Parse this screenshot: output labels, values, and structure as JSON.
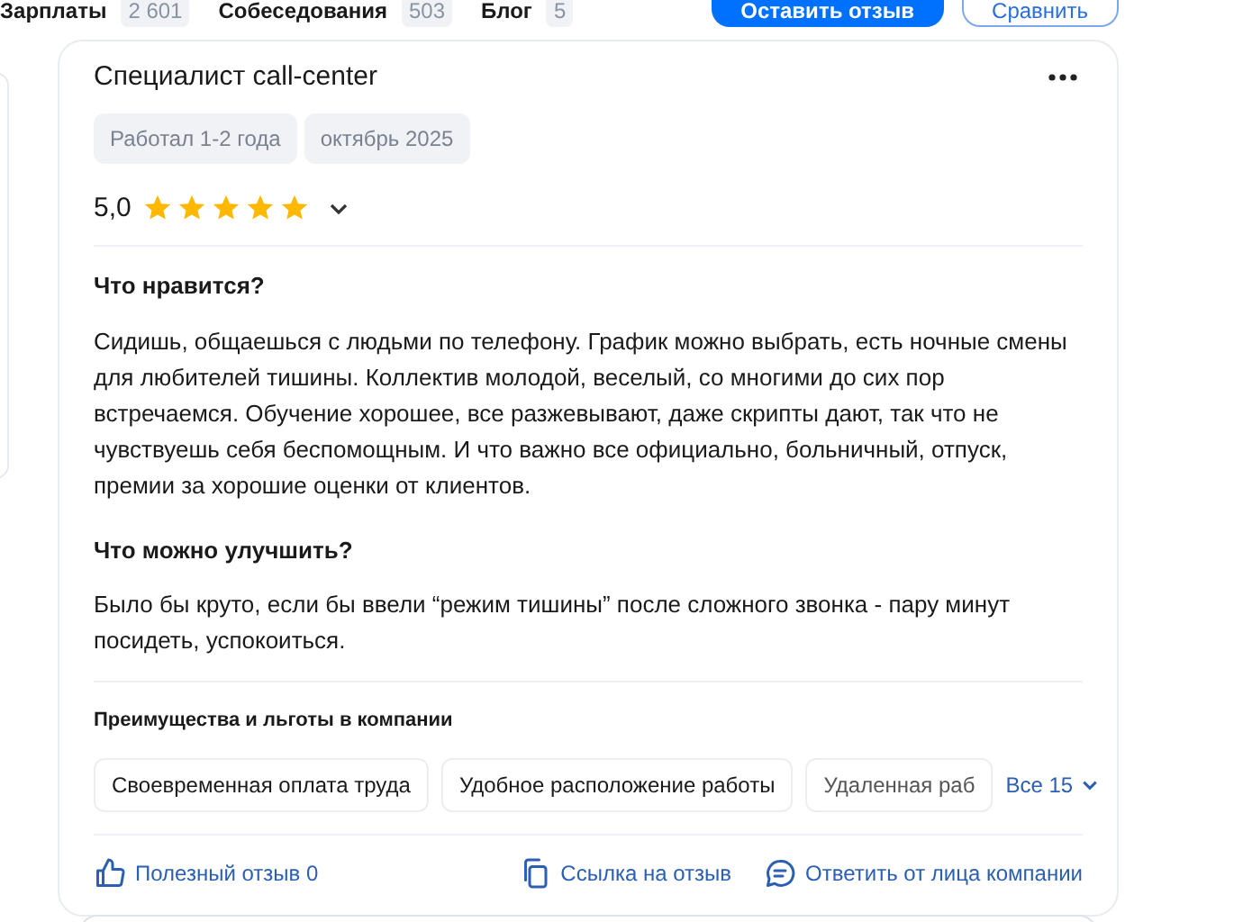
{
  "top_nav": {
    "tabs": [
      {
        "label": "Зарплаты",
        "count": "2 601"
      },
      {
        "label": "Собеседования",
        "count": "503"
      },
      {
        "label": "Блог",
        "count": "5"
      }
    ],
    "buttons": [
      {
        "label": "Оставить отзыв",
        "kind": "primary"
      },
      {
        "label": "Сравнить",
        "kind": "outline"
      }
    ]
  },
  "review": {
    "title": "Специалист call-center",
    "tags": [
      "Работал 1-2 года",
      "октябрь 2025"
    ],
    "rating": "5,0",
    "stars": 5,
    "sections": [
      {
        "heading": "Что нравится?",
        "text": "Сидишь, общаешься с людьми по телефону. График можно выбрать, есть ночные смены для любителей тишины. Коллектив молодой, веселый, со многими до сих пор встречаемся. Обучение хорошее, все разжевывают, даже скрипты дают, так что не чувствуешь себя беспомощным. И что важно все официально, больничный, отпуск, премии за хорошие оценки от клиентов."
      },
      {
        "heading": "Что можно улучшить?",
        "text": "Было бы круто, если бы ввели “режим тишины” после сложного звонка - пару минут посидеть, успокоиться."
      }
    ],
    "benefits": {
      "heading": "Преимущества и льготы в компании",
      "items": [
        "Своевременная оплата труда",
        "Удобное расположение работы",
        "Удаленная раб"
      ],
      "more": "Все 15"
    },
    "actions": [
      {
        "label": "Полезный отзыв 0",
        "kind": "like"
      },
      {
        "label": "Ссылка на отзыв",
        "kind": "link"
      },
      {
        "label": "Ответить от лица компании",
        "kind": "reply"
      }
    ]
  }
}
